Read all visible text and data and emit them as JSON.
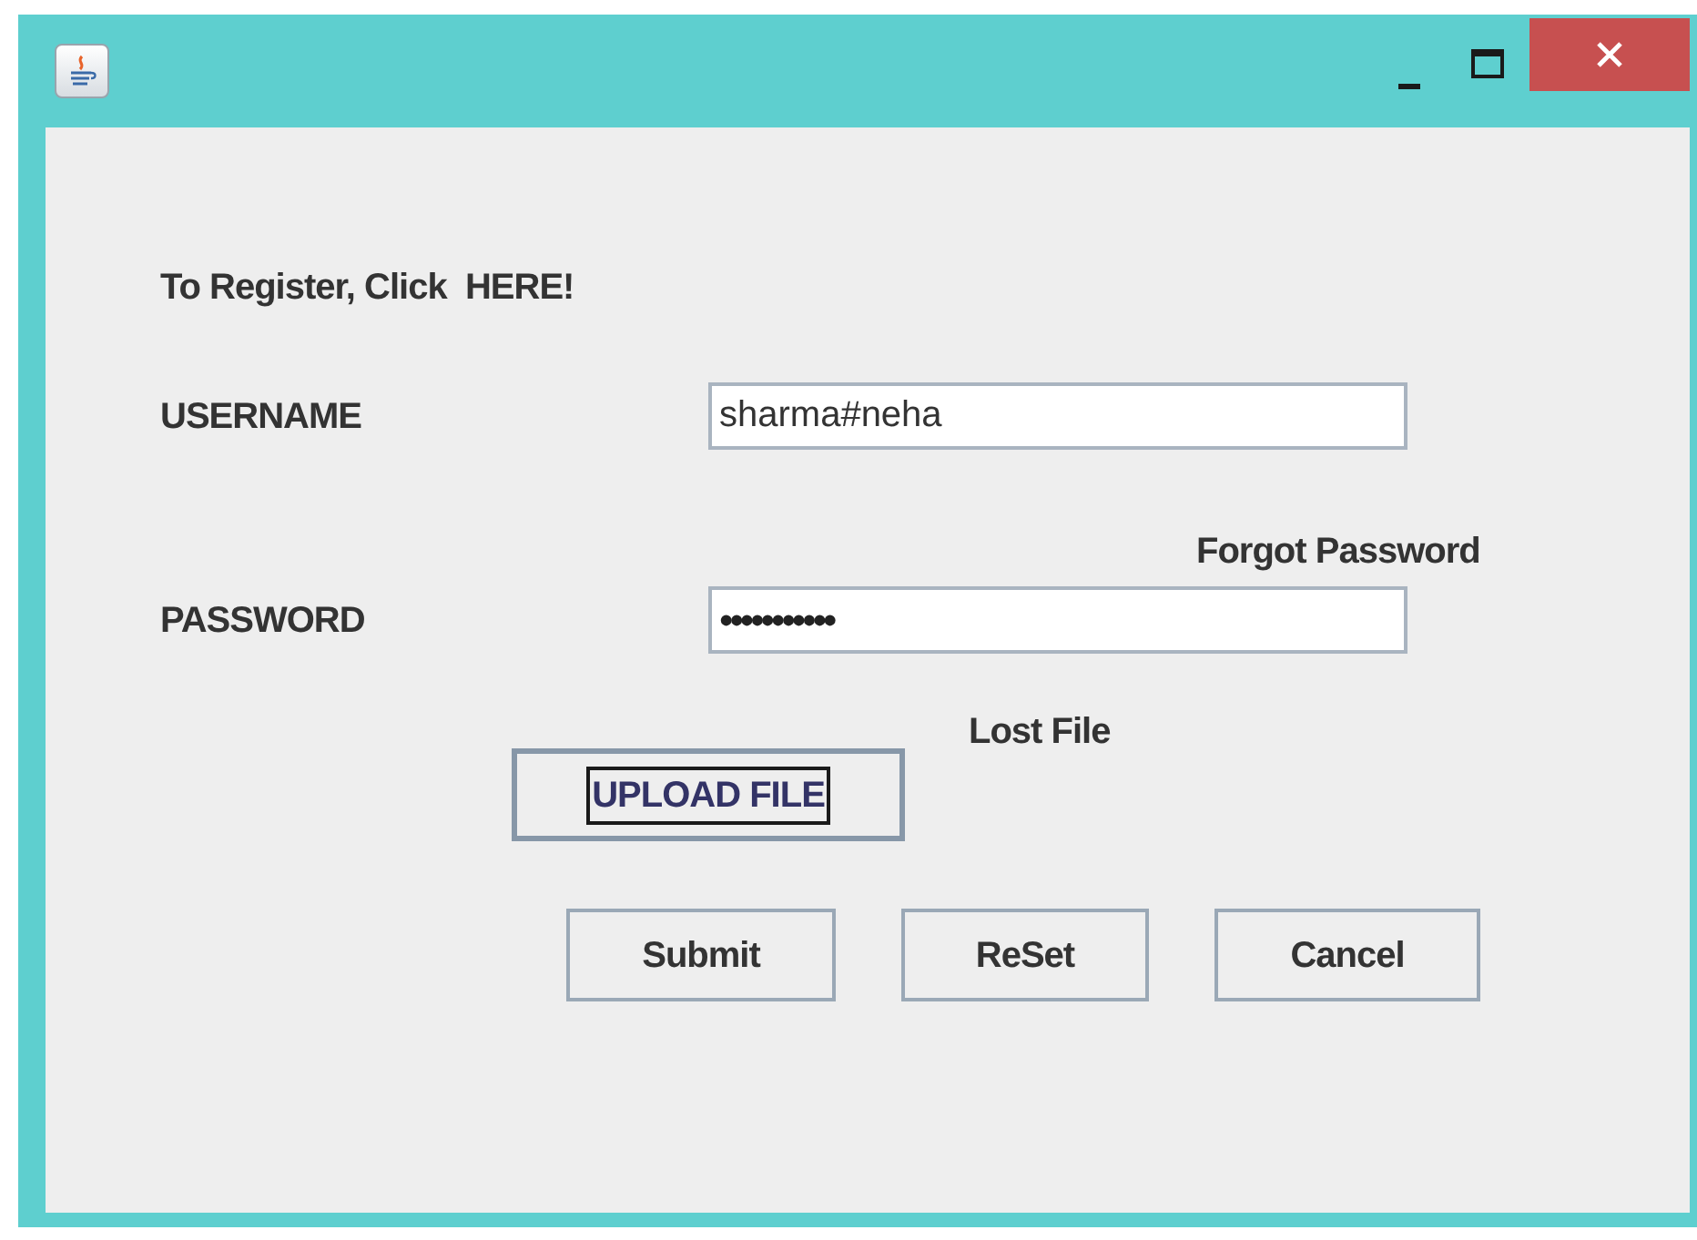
{
  "register_prompt": {
    "text": "To Register, Click  HERE!"
  },
  "username": {
    "label": "USERNAME",
    "value": "sharma#neha"
  },
  "forgot_password": {
    "text": "Forgot Password"
  },
  "password": {
    "label": "PASSWORD",
    "value": "•••••••••••"
  },
  "lost_file": {
    "text": "Lost File"
  },
  "upload_button": {
    "label": "UPLOAD FILE",
    "focused": true
  },
  "buttons": [
    {
      "label": "Submit"
    },
    {
      "label": "ReSet"
    },
    {
      "label": "Cancel"
    }
  ]
}
